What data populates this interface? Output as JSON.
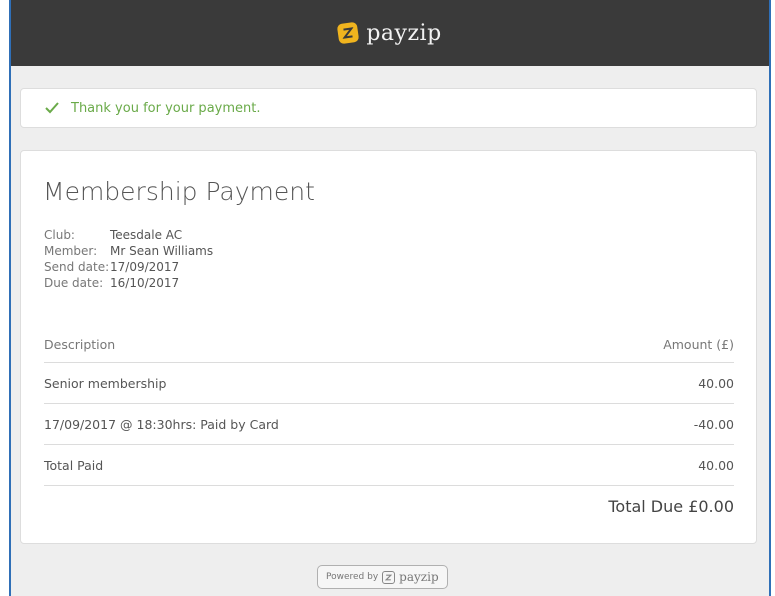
{
  "brand": {
    "name": "payzip",
    "logo_icon": "payzip-logo-icon",
    "accent": "#f0b41e"
  },
  "alert": {
    "message": "Thank you for your payment.",
    "icon": "check-icon",
    "color": "#6aaa49"
  },
  "payment": {
    "title": "Membership Payment",
    "meta": [
      {
        "label": "Club:",
        "value": "Teesdale AC"
      },
      {
        "label": "Member:",
        "value": "Mr Sean Williams"
      },
      {
        "label": "Send date:",
        "value": "17/09/2017"
      },
      {
        "label": "Due date:",
        "value": "16/10/2017"
      }
    ],
    "table": {
      "headers": {
        "description": "Description",
        "amount": "Amount (£)"
      },
      "rows": [
        {
          "description": "Senior membership",
          "amount": "40.00"
        },
        {
          "description": "17/09/2017 @ 18:30hrs: Paid by Card",
          "amount": "-40.00"
        },
        {
          "description": "Total Paid",
          "amount": "40.00"
        }
      ]
    },
    "total_due": "Total Due £0.00"
  },
  "footer": {
    "powered_by": "Powered by",
    "brand": "payzip"
  }
}
